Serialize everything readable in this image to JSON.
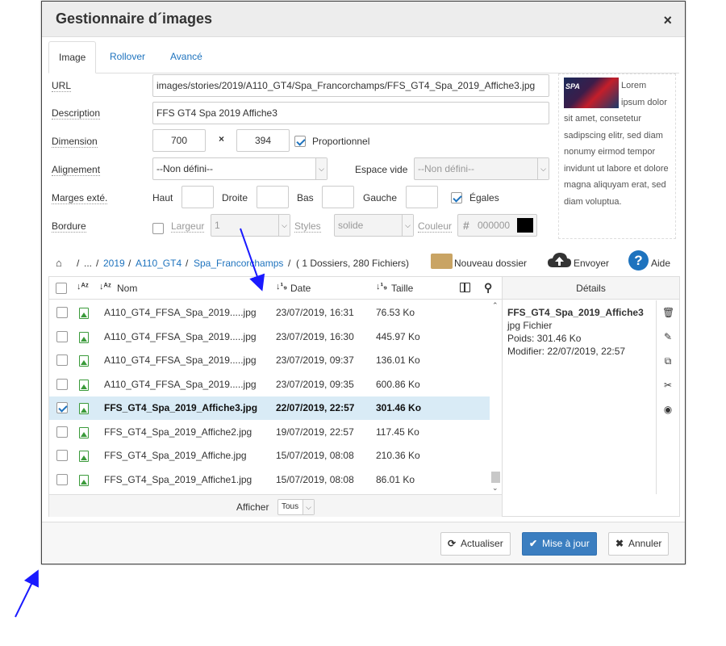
{
  "dialog": {
    "title": "Gestionnaire d´images",
    "close_label": "×"
  },
  "tabs": [
    {
      "label": "Image"
    },
    {
      "label": "Rollover"
    },
    {
      "label": "Avancé"
    }
  ],
  "form": {
    "url_label": "URL",
    "url_value": "images/stories/2019/A110_GT4/Spa_Francorchamps/FFS_GT4_Spa_2019_Affiche3.jpg",
    "description_label": "Description",
    "description_value": "FFS GT4 Spa 2019 Affiche3",
    "dimension_label": "Dimension",
    "width_value": "700",
    "times_sign": "×",
    "height_value": "394",
    "proportionnel_label": "Proportionnel",
    "alignement_label": "Alignement",
    "alignement_value": "--Non défini--",
    "espace_label": "Espace vide",
    "espace_value": "--Non défini--",
    "marges_label": "Marges exté.",
    "haut_label": "Haut",
    "droite_label": "Droite",
    "bas_label": "Bas",
    "gauche_label": "Gauche",
    "egales_label": "Égales",
    "bordure_label": "Bordure",
    "largeur_label": "Largeur",
    "largeur_value": "1",
    "styles_label": "Styles",
    "styles_value": "solide",
    "couleur_label": "Couleur",
    "couleur_value": "000000",
    "couleur_swatch": "#000000"
  },
  "preview": {
    "thumb_text": "SPA",
    "lorem": "Lorem ipsum dolor sit amet, consetetur sadipscing elitr, sed diam nonumy eirmod tempor invidunt ut labore et dolore magna aliquyam erat, sed diam voluptua."
  },
  "browser": {
    "crumbs": [
      "/",
      "...",
      "/",
      "2019",
      "/",
      "A110_GT4",
      "/",
      "Spa_Francorchamps",
      "/"
    ],
    "count": "( 1 Dossiers, 280 Fichiers)",
    "new_folder": "Nouveau dossier",
    "upload": "Envoyer",
    "help": "Aide"
  },
  "table": {
    "col_name": "Nom",
    "col_date": "Date",
    "col_size": "Taille",
    "rows": [
      {
        "name": "A110_GT4_FFSA_Spa_2019.....jpg",
        "date": "23/07/2019, 16:31",
        "size": "76.53 Ko"
      },
      {
        "name": "A110_GT4_FFSA_Spa_2019.....jpg",
        "date": "23/07/2019, 16:30",
        "size": "445.97 Ko"
      },
      {
        "name": "A110_GT4_FFSA_Spa_2019.....jpg",
        "date": "23/07/2019, 09:37",
        "size": "136.01 Ko"
      },
      {
        "name": "A110_GT4_FFSA_Spa_2019.....jpg",
        "date": "23/07/2019, 09:35",
        "size": "600.86 Ko"
      },
      {
        "name": "FFS_GT4_Spa_2019_Affiche3.jpg",
        "date": "22/07/2019, 22:57",
        "size": "301.46 Ko",
        "selected": true
      },
      {
        "name": "FFS_GT4_Spa_2019_Affiche2.jpg",
        "date": "19/07/2019, 22:57",
        "size": "117.45 Ko"
      },
      {
        "name": "FFS_GT4_Spa_2019_Affiche.jpg",
        "date": "15/07/2019, 08:08",
        "size": "210.36 Ko"
      },
      {
        "name": "FFS_GT4_Spa_2019_Affiche1.jpg",
        "date": "15/07/2019, 08:08",
        "size": "86.01 Ko"
      }
    ],
    "show_label": "Afficher",
    "show_value": "Tous"
  },
  "details": {
    "header": "Détails",
    "filename": "FFS_GT4_Spa_2019_Affiche3",
    "type": "jpg Fichier",
    "weight": "Poids: 301.46 Ko",
    "modified": "Modifier: 22/07/2019, 22:57"
  },
  "footer": {
    "refresh": "Actualiser",
    "update": "Mise à jour",
    "cancel": "Annuler"
  },
  "colors": {
    "accent": "#1e73be",
    "primary_button": "#3b7ec0",
    "selected_row": "#d9ebf6",
    "arrow": "#1a1aff"
  }
}
